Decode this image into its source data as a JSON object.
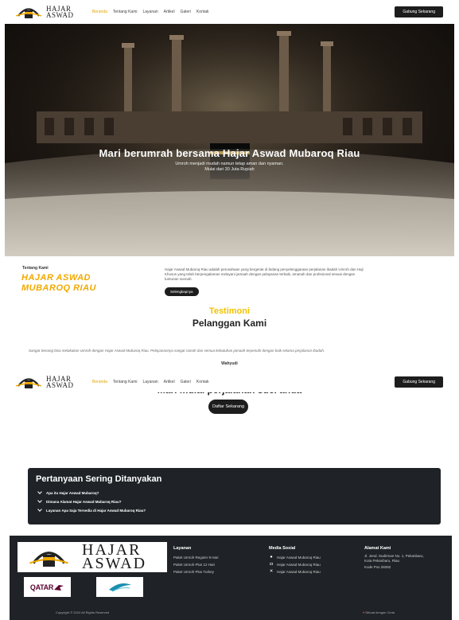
{
  "brand": {
    "line1": "HAJAR",
    "line2": "ASWAD"
  },
  "nav": {
    "links": [
      "Beranda",
      "Tentang Kami",
      "Layanan",
      "Artikel",
      "Galeri",
      "Kontak"
    ],
    "active_index": 0,
    "cta_label": "Gabung Sekarang"
  },
  "hero": {
    "title": "Mari berumrah bersama Hajar Aswad Mubaroq Riau",
    "subtitle_line1": "Umroh menjadi mudah namun tetap aman dan nyaman.",
    "subtitle_line2": "Mulai dari 30 Juta Rupiah"
  },
  "about": {
    "label": "Tentang Kami",
    "brand_line1": "HAJAR ASWAD",
    "brand_line2": "MUBAROQ RIAU",
    "text": "Hajar Aswad Mubaroq Riau adalah perusahaan yang bergerak di bidang penyelenggaraan perjalanan ibadah Umroh dan Haji Khusus yang telah berpengalaman melayani jamaah dengan pelayanan terbaik, amanah dan profesional sesuai dengan tuntunan sunnah.",
    "button_label": "Selengkapnya"
  },
  "testimonials": {
    "title": "Testimoni",
    "subtitle": "Pelanggan Kami",
    "quote": "Sangat Senang bisa melakukan Umroh dengan Hajar Aswad Mubaroq Riau. Pelayanannya sangat ramah dan semua kebutuhan jamaah terpenuhi dengan baik selama perjalanan ibadah.",
    "author": "Wahyudi"
  },
  "cta": {
    "title": "Mari mulai perjalanan suci anda",
    "button_label": "Daftar Sekarang"
  },
  "faq": {
    "title": "Pertanyaan Sering Ditanyakan",
    "items": [
      "Apa itu Hajar Aswad Mubaroq?",
      "Dimana Alamat Hajar Aswad Mubaroq Riau?",
      "Layanan Apa Saja Tersedia di Hajar Aswad Mubaroq Riau?"
    ]
  },
  "footer": {
    "partners": [
      "QATAR",
      "Garuda Indonesia"
    ],
    "services": {
      "title": "Layanan",
      "items": [
        "Paket Umroh Reguler 9 Hari",
        "Paket Umroh Plus 12 Hari",
        "Paket Umroh Plus Turkey"
      ]
    },
    "social": {
      "title": "Media Sosial",
      "items": [
        "Hajar Aswad Mubaroq Riau",
        "Hajar Aswad Mubaroq Riau",
        "Hajar Aswad Mubaroq Riau"
      ],
      "icons": [
        "facebook-icon",
        "instagram-icon",
        "x-icon"
      ]
    },
    "address": {
      "title": "Alamat Kami",
      "lines": [
        "Jl. Jend. Sudirman No. 1, Pekanbaru,",
        "Kota Pekanbaru, Riau",
        "Kode Pos 28282"
      ]
    },
    "copyright": "Copyright © 2024 All Rights Reserved",
    "made_with": "Dibuat dengan Cinta"
  },
  "colors": {
    "accent": "#f2a900",
    "dark": "#1f2327"
  }
}
